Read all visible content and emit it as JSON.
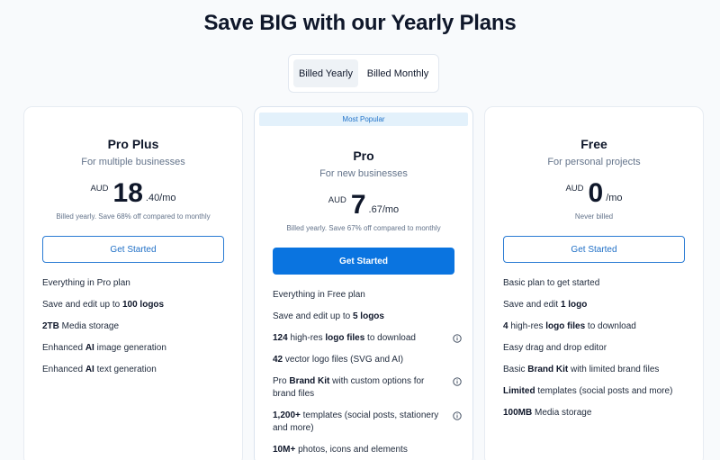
{
  "page": {
    "title": "Save BIG with our Yearly Plans"
  },
  "toggle": {
    "yearly_label": "Billed Yearly",
    "monthly_label": "Billed Monthly",
    "selected": "Billed Yearly"
  },
  "plans": [
    {
      "name": "Pro Plus",
      "subtitle": "For multiple businesses",
      "currency": "AUD",
      "amount": "18",
      "cents": ".40/mo",
      "billed_note": "Billed yearly. Save 68% off compared to monthly",
      "cta": "Get Started",
      "features": [
        {
          "pre": "Everything in Pro plan",
          "bold": "",
          "post": ""
        },
        {
          "pre": "Save and edit up to ",
          "bold": "100 logos",
          "post": ""
        },
        {
          "pre": "",
          "bold": "2TB",
          "post": " Media storage"
        },
        {
          "pre": "Enhanced ",
          "bold": "AI",
          "post": " image generation"
        },
        {
          "pre": "Enhanced ",
          "bold": "AI",
          "post": " text generation"
        }
      ]
    },
    {
      "badge": "Most Popular",
      "name": "Pro",
      "subtitle": "For new businesses",
      "currency": "AUD",
      "amount": "7",
      "cents": ".67/mo",
      "billed_note": "Billed yearly. Save 67% off compared to monthly",
      "cta": "Get Started",
      "features": [
        {
          "pre": "Everything in Free plan",
          "bold": "",
          "post": ""
        },
        {
          "pre": "Save and edit up to ",
          "bold": "5 logos",
          "post": ""
        },
        {
          "pre": "",
          "bold": "124",
          "post": " high-res ",
          "bold2": "logo files",
          "post2": " to download",
          "info": true
        },
        {
          "pre": "",
          "bold": "42",
          "post": " vector logo files (SVG and AI)"
        },
        {
          "pre": "Pro ",
          "bold": "Brand Kit",
          "post": " with custom options for brand files",
          "info": true
        },
        {
          "pre": "",
          "bold": "1,200+",
          "post": " templates (social posts, stationery and more)",
          "info": true
        },
        {
          "pre": "",
          "bold": "10M+",
          "post": " photos, icons and elements"
        }
      ]
    },
    {
      "name": "Free",
      "subtitle": "For personal projects",
      "currency": "AUD",
      "amount": "0",
      "cents": "/mo",
      "billed_note": "Never billed",
      "cta": "Get Started",
      "features": [
        {
          "pre": "Basic plan to get started",
          "bold": "",
          "post": ""
        },
        {
          "pre": "Save and edit ",
          "bold": "1 logo",
          "post": ""
        },
        {
          "pre": "",
          "bold": "4",
          "post": " high-res ",
          "bold2": "logo files",
          "post2": " to download"
        },
        {
          "pre": "Easy drag and drop editor",
          "bold": "",
          "post": ""
        },
        {
          "pre": "Basic ",
          "bold": "Brand Kit",
          "post": " with limited brand files"
        },
        {
          "pre": "",
          "bold": "Limited",
          "post": " templates (social posts and more)"
        },
        {
          "pre": "",
          "bold": "100MB",
          "post": " Media storage"
        }
      ]
    }
  ],
  "icons": {
    "info": "info-circle-icon"
  },
  "colors": {
    "accent": "#0a74e0",
    "badge_bg": "#e3f1fb",
    "title": "#0f172a"
  }
}
